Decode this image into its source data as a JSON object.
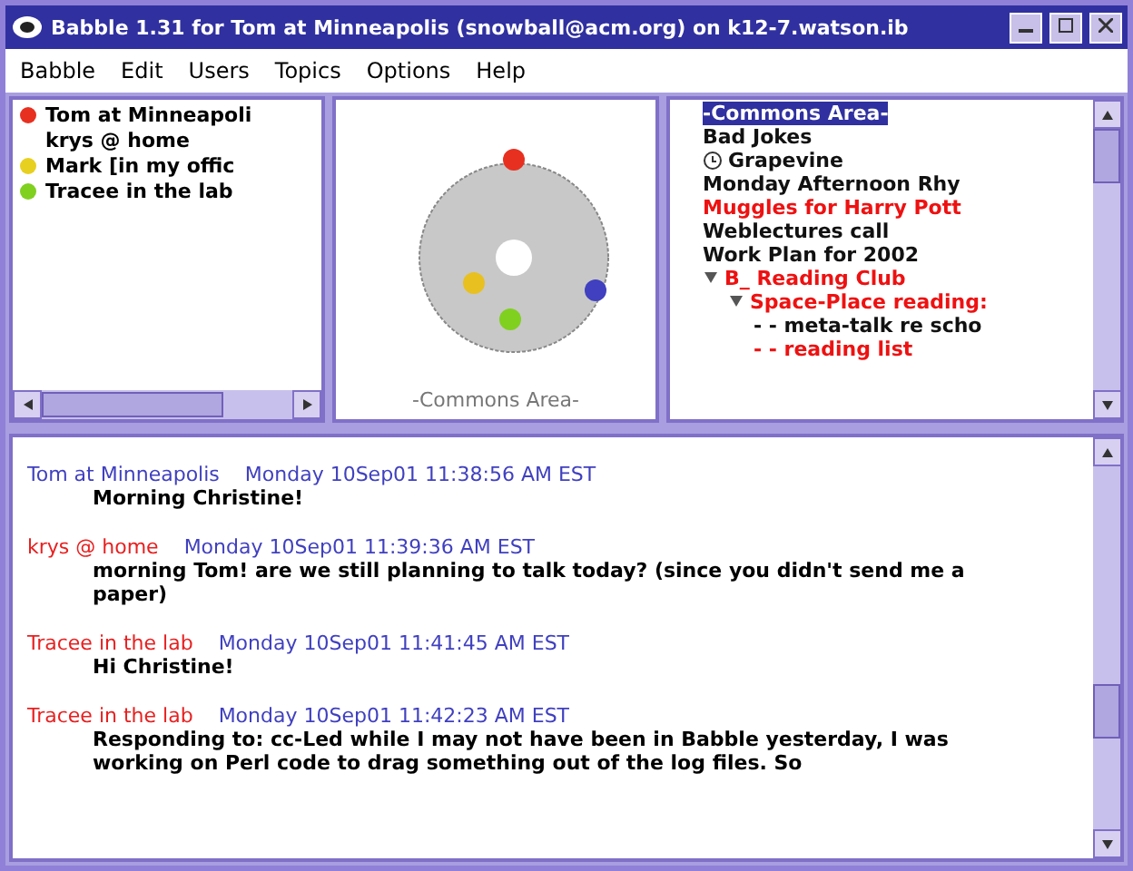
{
  "window": {
    "title": "Babble 1.31 for Tom at Minneapolis (snowball@acm.org) on k12-7.watson.ib"
  },
  "menu": [
    "Babble",
    "Edit",
    "Users",
    "Topics",
    "Options",
    "Help"
  ],
  "users": [
    {
      "name": "Tom at Minneapoli",
      "color": "#e83020"
    },
    {
      "name": "krys @ home"
    },
    {
      "name": "Mark [in my offic",
      "color": "#e8d020"
    },
    {
      "name": "Tracee in the lab",
      "color": "#80d020"
    }
  ],
  "social_proxy": {
    "caption": "-Commons Area-",
    "figures": [
      {
        "color": "#e83020"
      },
      {
        "color": "#e8c020"
      },
      {
        "color": "#80d020"
      },
      {
        "color": "#4040c0"
      }
    ]
  },
  "topics": [
    {
      "label": "-Commons Area-",
      "selected": true,
      "unread": false
    },
    {
      "label": "Bad Jokes",
      "selected": false,
      "unread": false
    },
    {
      "label": "Grapevine",
      "selected": false,
      "unread": false,
      "kind": "clock"
    },
    {
      "label": "Monday Afternoon Rhy",
      "selected": false,
      "unread": false
    },
    {
      "label": "Muggles for Harry Pott",
      "selected": false,
      "unread": true
    },
    {
      "label": "Weblectures call",
      "selected": false,
      "unread": false
    },
    {
      "label": "Work Plan for 2002",
      "selected": false,
      "unread": false
    },
    {
      "label": "B_ Reading Club",
      "selected": false,
      "unread": true,
      "expanded": true,
      "children": [
        {
          "label": "Space-Place reading:",
          "selected": false,
          "unread": true,
          "expanded": true,
          "children": [
            {
              "label": "- - meta-talk re scho",
              "selected": false,
              "unread": false
            },
            {
              "label": "- - reading list",
              "selected": false,
              "unread": true
            }
          ]
        }
      ]
    }
  ],
  "messages": [
    {
      "author": "Tom at Minneapolis",
      "color": "#4040c0",
      "time": "Monday 10Sep01 11:38:56 AM EST",
      "body": "Morning Christine!"
    },
    {
      "author": "krys @ home",
      "color": "#e82020",
      "time": "Monday 10Sep01 11:39:36 AM EST",
      "body": "morning Tom! are we still planning to talk today?  (since you didn't send me a paper)"
    },
    {
      "author": "Tracee in the lab",
      "color": "#e82020",
      "time": "Monday 10Sep01 11:41:45 AM EST",
      "body": "Hi Christine!"
    },
    {
      "author": "Tracee in the lab",
      "color": "#e82020",
      "time": "Monday 10Sep01 11:42:23 AM EST",
      "body": "Responding to: cc-Led while I may not have been in Babble yesterday, I was working on Perl code to drag something out of the log files.  So"
    }
  ]
}
